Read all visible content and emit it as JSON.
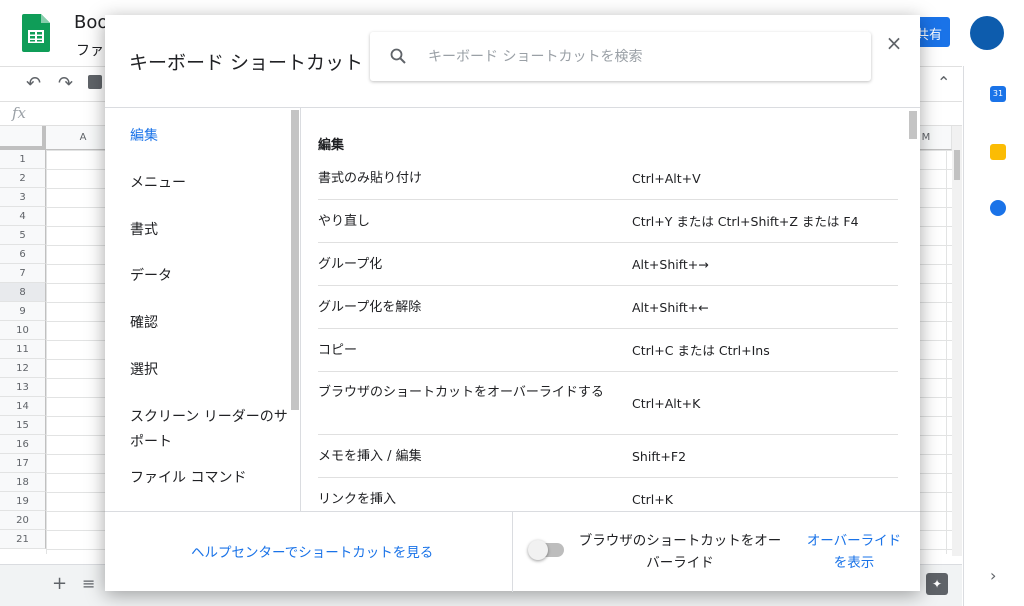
{
  "app": {
    "title": "Boo",
    "menu_fragment": "ファ",
    "share_label": "共有",
    "formula_icon": "fx",
    "columns": [
      "A",
      "M"
    ],
    "rows": [
      "1",
      "2",
      "3",
      "4",
      "5",
      "6",
      "7",
      "8",
      "9",
      "10",
      "11",
      "12",
      "13",
      "14",
      "15",
      "16",
      "17",
      "18",
      "19",
      "20",
      "21"
    ],
    "selected_row": "8",
    "calendar_badge": "31",
    "colors": {
      "accent": "#1a73e8",
      "sheets_green": "#0f9d58",
      "keep_yellow": "#fbbc04"
    }
  },
  "dialog": {
    "title": "キーボード ショートカット",
    "search_placeholder": "キーボード ショートカットを検索",
    "close_icon": "×",
    "categories": [
      "編集",
      "メニュー",
      "書式",
      "データ",
      "確認",
      "選択",
      "スクリーン リーダーのサポート",
      "ファイル コマンド"
    ],
    "active_category": "編集",
    "section_heading": "編集",
    "shortcuts": [
      {
        "name": "書式のみ貼り付け",
        "keys": "Ctrl+Alt+V"
      },
      {
        "name": "やり直し",
        "keys": "Ctrl+Y または Ctrl+Shift+Z または F4"
      },
      {
        "name": "グループ化",
        "keys": "Alt+Shift+→"
      },
      {
        "name": "グループ化を解除",
        "keys": "Alt+Shift+←"
      },
      {
        "name": "コピー",
        "keys": "Ctrl+C または Ctrl+Ins"
      },
      {
        "name": "ブラウザのショートカットをオーバーライドする",
        "keys": "Ctrl+Alt+K"
      },
      {
        "name": "メモを挿入 / 編集",
        "keys": "Shift+F2"
      },
      {
        "name": "リンクを挿入",
        "keys": "Ctrl+K"
      }
    ],
    "footer": {
      "help_link": "ヘルプセンターでショートカットを見る",
      "override_label": "ブラウザのショートカットをオーバーライド",
      "override_link": "オーバーライドを表示",
      "toggle_on": false
    }
  }
}
